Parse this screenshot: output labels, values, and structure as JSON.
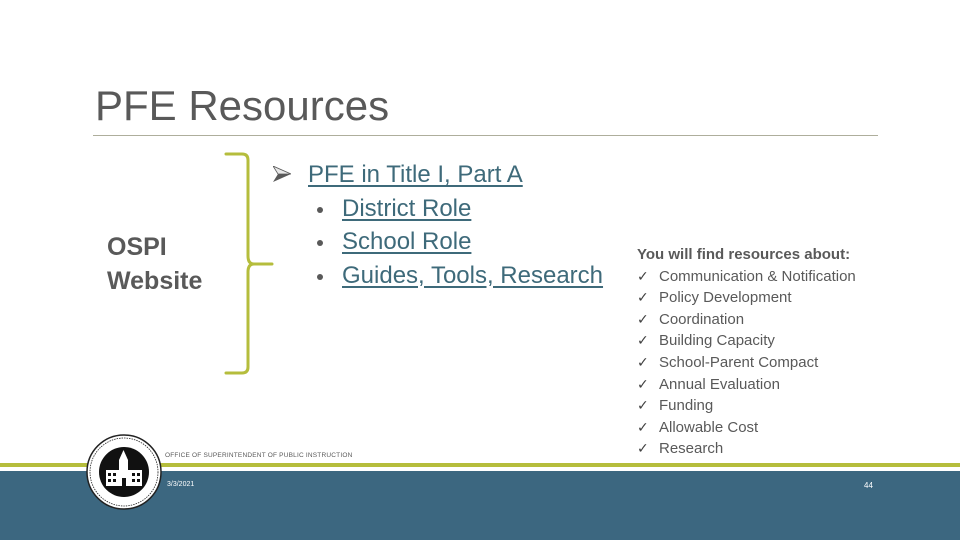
{
  "slide": {
    "title": "PFE Resources",
    "left_label_line1": "OSPI",
    "left_label_line2": "Website"
  },
  "links": {
    "main": "PFE in Title I, Part A",
    "sub": [
      "District Role",
      "School Role",
      "Guides, Tools, Research"
    ]
  },
  "resources": {
    "heading": "You will find resources about:",
    "check_icon": "✓",
    "items": [
      "Communication & Notification",
      "Policy Development",
      "Coordination",
      "Building Capacity",
      "School-Parent Compact",
      "Annual Evaluation",
      "Funding",
      "Allowable Cost",
      "Research"
    ]
  },
  "footer": {
    "org": "OFFICE OF SUPERINTENDENT OF PUBLIC INSTRUCTION",
    "date": "3/3/2021",
    "page": "44"
  },
  "colors": {
    "accent_green": "#b5bd3c",
    "footer_blue": "#3c6780",
    "link": "#3e6a7a",
    "text": "#595959"
  }
}
